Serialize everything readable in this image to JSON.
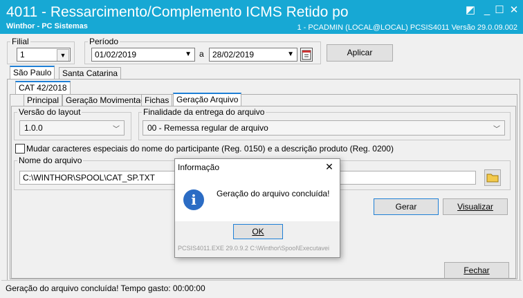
{
  "window": {
    "title": "4011 - Ressarcimento/Complemento ICMS Retido po",
    "subtitle": "Winthor - PC Sistemas",
    "status_info": "1 - PCADMIN (LOCAL@LOCAL)   PCSIS4011  Versão  29.0.09.002",
    "restore_glyph": "◩",
    "minimize_glyph": "_",
    "maximize_glyph": "☐",
    "close_glyph": "✕"
  },
  "filial": {
    "legend": "Filial",
    "value": "1"
  },
  "periodo": {
    "legend": "Período",
    "start": "01/02/2019",
    "sep": "a",
    "end": "28/02/2019"
  },
  "buttons": {
    "aplicar": "Aplicar",
    "gerar": "Gerar",
    "visualizar": "Visualizar",
    "fechar": "Fechar"
  },
  "state_tabs": [
    "São Paulo",
    "Santa Catarina"
  ],
  "cat_tab": "CAT 42/2018",
  "sub_tabs": [
    "Principal",
    "Geração Movimentação",
    "Fichas",
    "Geração Arquivo"
  ],
  "layout_version": {
    "legend": "Versão do layout",
    "value": "1.0.0"
  },
  "finalidade": {
    "legend": "Finalidade da entrega do arquivo",
    "value": "00 - Remessa regular de arquivo"
  },
  "checkbox_label": "Mudar caracteres especiais do nome do participante (Reg. 0150) e a descrição produto (Reg. 0200)",
  "arquivo": {
    "legend": "Nome do arquivo",
    "value": "C:\\WINTHOR\\SPOOL\\CAT_SP.TXT"
  },
  "status_bar": "Geração do arquivo concluída! Tempo gasto: 00:00:00",
  "dialog": {
    "title": "Informação",
    "message": "Geração do arquivo concluída!",
    "ok": "OK",
    "footer": "PCSIS4011.EXE 29.0.9.2 C:\\Winthor\\Spool\\Executavei",
    "close_glyph": "✕",
    "info_glyph": "i"
  },
  "colors": {
    "titlebar": "#17a8d4",
    "accent": "#1e7fd6",
    "dialog_icon": "#2b6cc4"
  }
}
